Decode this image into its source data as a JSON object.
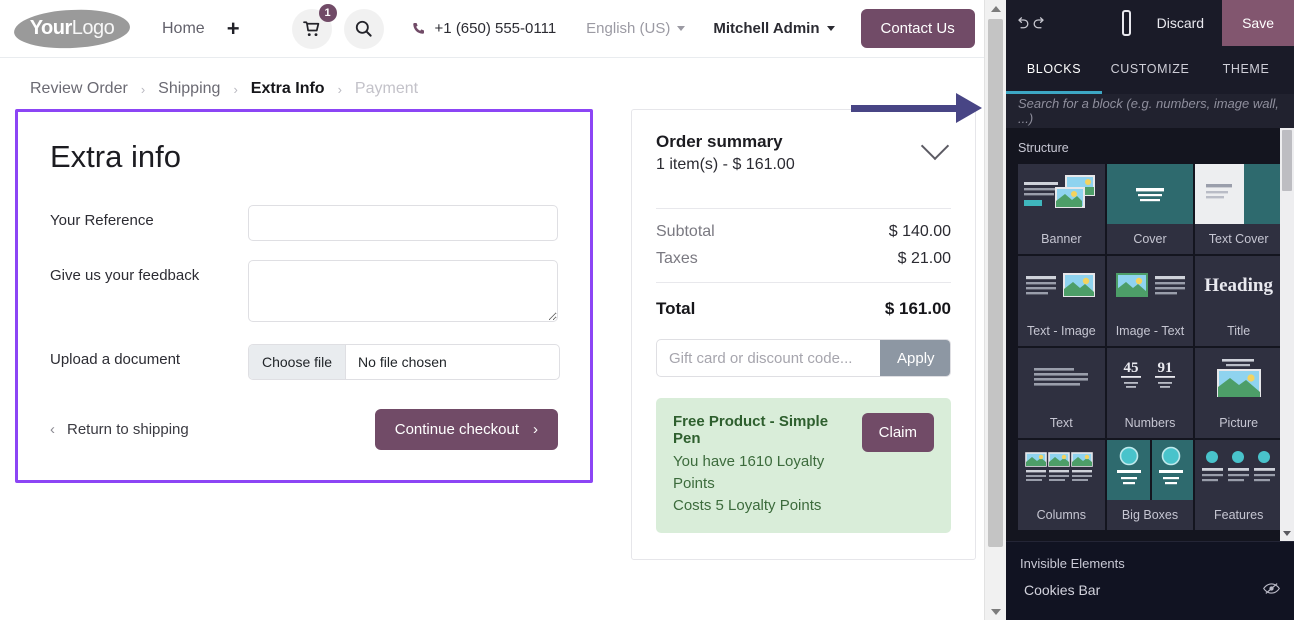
{
  "site": {
    "logo_bold": "Your",
    "logo_thin": "Logo",
    "nav_home": "Home",
    "nav_plus": "+",
    "cart_count": "1",
    "cart_icon": "shopping-cart-icon",
    "search_icon": "search-icon",
    "phone_icon": "phone-icon",
    "phone": "+1 (650) 555-0111",
    "language": "English (US)",
    "user": "Mitchell Admin",
    "contact_label": "Contact Us"
  },
  "breadcrumb": {
    "items": [
      {
        "label": "Review Order",
        "state": "done"
      },
      {
        "label": "Shipping",
        "state": "done"
      },
      {
        "label": "Extra Info",
        "state": "active"
      },
      {
        "label": "Payment",
        "state": "muted"
      }
    ],
    "separator": "›"
  },
  "extra_info": {
    "heading": "Extra info",
    "fields": [
      {
        "label": "Your Reference",
        "type": "text",
        "value": "",
        "placeholder": ""
      },
      {
        "label": "Give us your feedback",
        "type": "textarea",
        "value": "",
        "placeholder": ""
      },
      {
        "label": "Upload a document",
        "type": "file",
        "button": "Choose file",
        "status": "No file chosen"
      }
    ],
    "back_label": "Return to shipping",
    "back_chevron": "‹",
    "continue_label": "Continue checkout",
    "continue_chevron": "›"
  },
  "order_summary": {
    "title": "Order summary",
    "subtitle": "1  item(s) -  $ 161.00",
    "collapse_icon": "chevron-down-icon",
    "rows": [
      {
        "label": "Subtotal",
        "value": "$ 140.00"
      },
      {
        "label": "Taxes",
        "value": "$ 21.00"
      }
    ],
    "total_label": "Total",
    "total_value": "$ 161.00",
    "promo_placeholder": "Gift card or discount code...",
    "promo_value": "",
    "promo_button": "Apply",
    "reward": {
      "title": "Free Product - Simple Pen",
      "line1": "You have 1610 Loyalty Points",
      "line2": "Costs 5 Loyalty Points",
      "button": "Claim"
    }
  },
  "editor": {
    "undo_icon": "undo-icon",
    "redo_icon": "redo-icon",
    "mobile_icon": "mobile-preview-icon",
    "discard_label": "Discard",
    "save_label": "Save",
    "tabs": [
      {
        "label": "BLOCKS",
        "active": true
      },
      {
        "label": "CUSTOMIZE",
        "active": false
      },
      {
        "label": "THEME",
        "active": false
      }
    ],
    "search_placeholder": "Search for a block (e.g. numbers, image wall, ...)",
    "section_title": "Structure",
    "blocks": [
      {
        "label": "Banner",
        "art": "banner"
      },
      {
        "label": "Cover",
        "art": "cover"
      },
      {
        "label": "Text Cover",
        "art": "textcover"
      },
      {
        "label": "Text - Image",
        "art": "text-image"
      },
      {
        "label": "Image - Text",
        "art": "image-text"
      },
      {
        "label": "Title",
        "art": "title",
        "art_text": "Heading"
      },
      {
        "label": "Text",
        "art": "text"
      },
      {
        "label": "Numbers",
        "art": "numbers",
        "art_text_a": "45",
        "art_text_b": "91"
      },
      {
        "label": "Picture",
        "art": "picture"
      },
      {
        "label": "Columns",
        "art": "columns"
      },
      {
        "label": "Big Boxes",
        "art": "bigboxes"
      },
      {
        "label": "Features",
        "art": "features"
      }
    ],
    "invisible_title": "Invisible Elements",
    "invisible_items": [
      {
        "label": "Cookies Bar",
        "icon": "eye-off-icon"
      }
    ]
  },
  "annotation": {
    "arrow": "right-arrow-annotation",
    "highlight": "extra-info-highlight-box",
    "arrow_color": "#484585",
    "highlight_color": "#8c45f5"
  }
}
